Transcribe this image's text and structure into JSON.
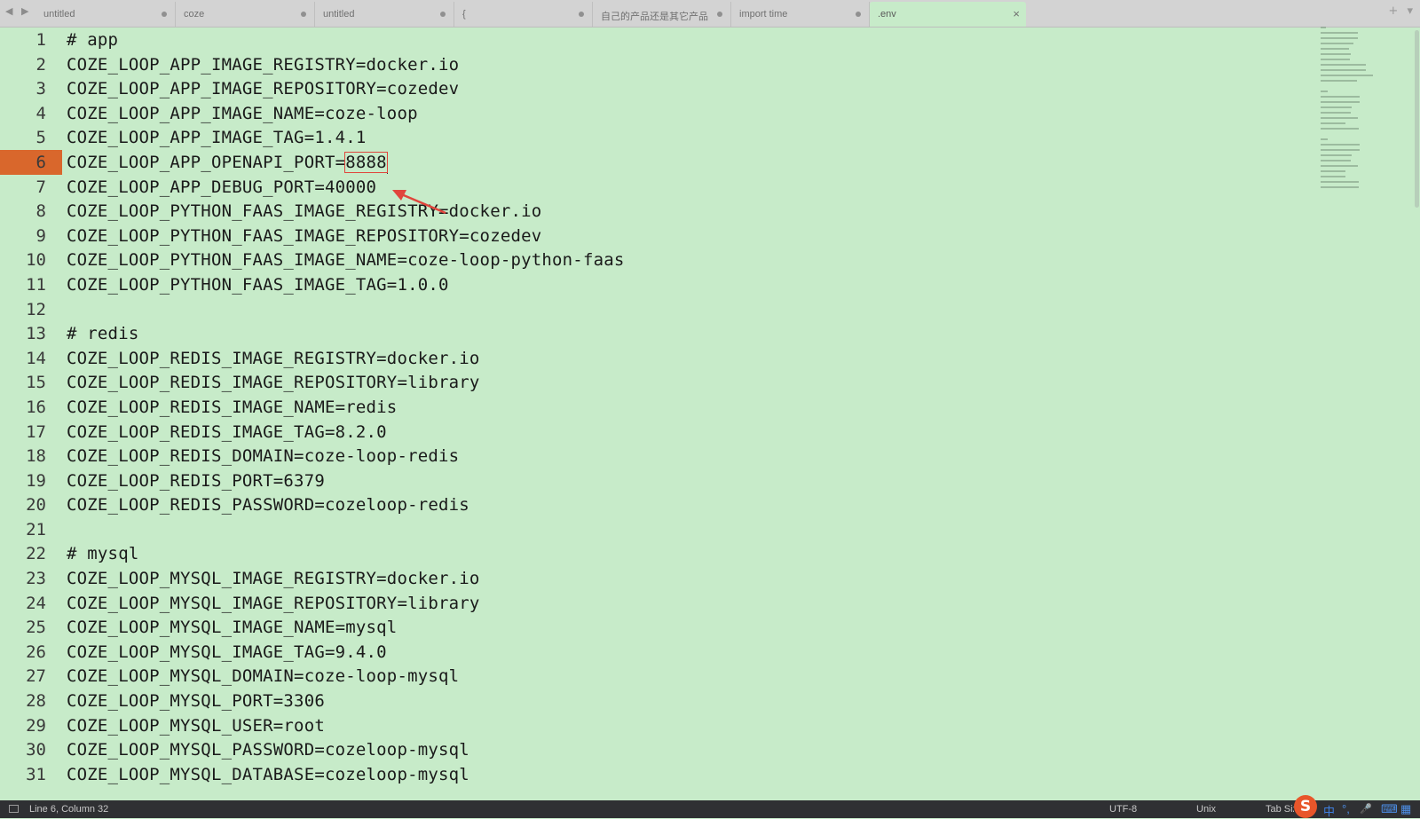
{
  "tabs": [
    {
      "label": "untitled",
      "modified": true
    },
    {
      "label": "coze",
      "modified": true
    },
    {
      "label": "untitled",
      "modified": true
    },
    {
      "label": "{",
      "modified": true
    },
    {
      "label": "自己的产品还是其它产品",
      "modified": true
    },
    {
      "label": "import time",
      "modified": true
    },
    {
      "label": ".env",
      "active": true
    }
  ],
  "tabbar": {
    "nav_glyphs": "◀ ▶",
    "new_tab_glyph": "+",
    "menu_glyph": "▾",
    "close_glyph": "×"
  },
  "editor": {
    "current_line": 6,
    "highlight_value": "8888",
    "lines": [
      {
        "n": "1",
        "text": "# app"
      },
      {
        "n": "2",
        "text": "COZE_LOOP_APP_IMAGE_REGISTRY=docker.io"
      },
      {
        "n": "3",
        "text": "COZE_LOOP_APP_IMAGE_REPOSITORY=cozedev"
      },
      {
        "n": "4",
        "text": "COZE_LOOP_APP_IMAGE_NAME=coze-loop"
      },
      {
        "n": "5",
        "text": "COZE_LOOP_APP_IMAGE_TAG=1.4.1"
      },
      {
        "n": "6",
        "text": "COZE_LOOP_APP_OPENAPI_PORT=",
        "value": "8888"
      },
      {
        "n": "7",
        "text": "COZE_LOOP_APP_DEBUG_PORT=40000"
      },
      {
        "n": "8",
        "text": "COZE_LOOP_PYTHON_FAAS_IMAGE_REGISTRY=docker.io"
      },
      {
        "n": "9",
        "text": "COZE_LOOP_PYTHON_FAAS_IMAGE_REPOSITORY=cozedev"
      },
      {
        "n": "10",
        "text": "COZE_LOOP_PYTHON_FAAS_IMAGE_NAME=coze-loop-python-faas"
      },
      {
        "n": "11",
        "text": "COZE_LOOP_PYTHON_FAAS_IMAGE_TAG=1.0.0"
      },
      {
        "n": "12",
        "text": ""
      },
      {
        "n": "13",
        "text": "# redis"
      },
      {
        "n": "14",
        "text": "COZE_LOOP_REDIS_IMAGE_REGISTRY=docker.io"
      },
      {
        "n": "15",
        "text": "COZE_LOOP_REDIS_IMAGE_REPOSITORY=library"
      },
      {
        "n": "16",
        "text": "COZE_LOOP_REDIS_IMAGE_NAME=redis"
      },
      {
        "n": "17",
        "text": "COZE_LOOP_REDIS_IMAGE_TAG=8.2.0"
      },
      {
        "n": "18",
        "text": "COZE_LOOP_REDIS_DOMAIN=coze-loop-redis"
      },
      {
        "n": "19",
        "text": "COZE_LOOP_REDIS_PORT=6379"
      },
      {
        "n": "20",
        "text": "COZE_LOOP_REDIS_PASSWORD=cozeloop-redis"
      },
      {
        "n": "21",
        "text": ""
      },
      {
        "n": "22",
        "text": "# mysql"
      },
      {
        "n": "23",
        "text": "COZE_LOOP_MYSQL_IMAGE_REGISTRY=docker.io"
      },
      {
        "n": "24",
        "text": "COZE_LOOP_MYSQL_IMAGE_REPOSITORY=library"
      },
      {
        "n": "25",
        "text": "COZE_LOOP_MYSQL_IMAGE_NAME=mysql"
      },
      {
        "n": "26",
        "text": "COZE_LOOP_MYSQL_IMAGE_TAG=9.4.0"
      },
      {
        "n": "27",
        "text": "COZE_LOOP_MYSQL_DOMAIN=coze-loop-mysql"
      },
      {
        "n": "28",
        "text": "COZE_LOOP_MYSQL_PORT=3306"
      },
      {
        "n": "29",
        "text": "COZE_LOOP_MYSQL_USER=root"
      },
      {
        "n": "30",
        "text": "COZE_LOOP_MYSQL_PASSWORD=cozeloop-mysql"
      },
      {
        "n": "31",
        "text": "COZE_LOOP_MYSQL_DATABASE=cozeloop-mysql"
      }
    ]
  },
  "statusbar": {
    "position": "Line 6, Column 32",
    "encoding": "UTF-8",
    "line_endings": "Unix",
    "tab_size": "Tab Siz"
  },
  "ime": {
    "logo": "S",
    "lang": "中",
    "punct": "°,",
    "mic": "🎤",
    "keyboard": "⌨",
    "grid": "▦"
  },
  "colors": {
    "editor_bg": "#c7ebc9",
    "current_line_gutter": "#d9672c",
    "annotation_red": "#e0453c",
    "statusbar_bg": "#2f3033"
  }
}
